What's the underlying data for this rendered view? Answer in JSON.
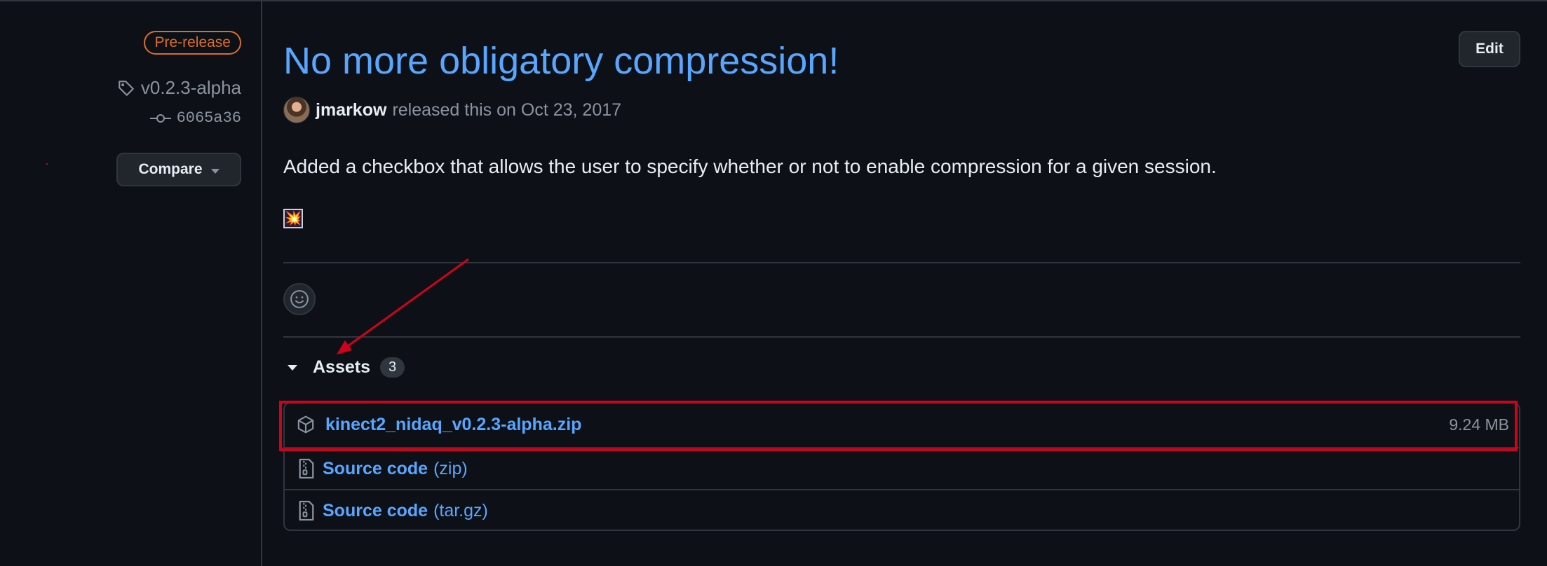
{
  "release": {
    "badge": "Pre-release",
    "tag": "v0.2.3-alpha",
    "commit": "6065a36",
    "compare_label": "Compare",
    "title": "No more obligatory compression!",
    "edit_label": "Edit",
    "author": "jmarkow",
    "released_text": "released this on Oct 23, 2017",
    "description": "Added a checkbox that allows the user to specify whether or not to enable compression for a given session.",
    "emoji": "💥"
  },
  "assets": {
    "title": "Assets",
    "count": "3",
    "items": [
      {
        "name": "kinect2_nidaq_v0.2.3-alpha.zip",
        "size": "9.24 MB",
        "icon": "package-icon"
      },
      {
        "name": "Source code",
        "suffix": "(zip)",
        "icon": "file-zip-icon"
      },
      {
        "name": "Source code",
        "suffix": "(tar.gz)",
        "icon": "file-zip-icon"
      }
    ]
  },
  "colors": {
    "background": "#0d1117",
    "link": "#58a6ff",
    "prerelease": "#db6d28",
    "annotation_red": "#d0021b",
    "border": "#30363d",
    "muted": "#8b949e"
  }
}
